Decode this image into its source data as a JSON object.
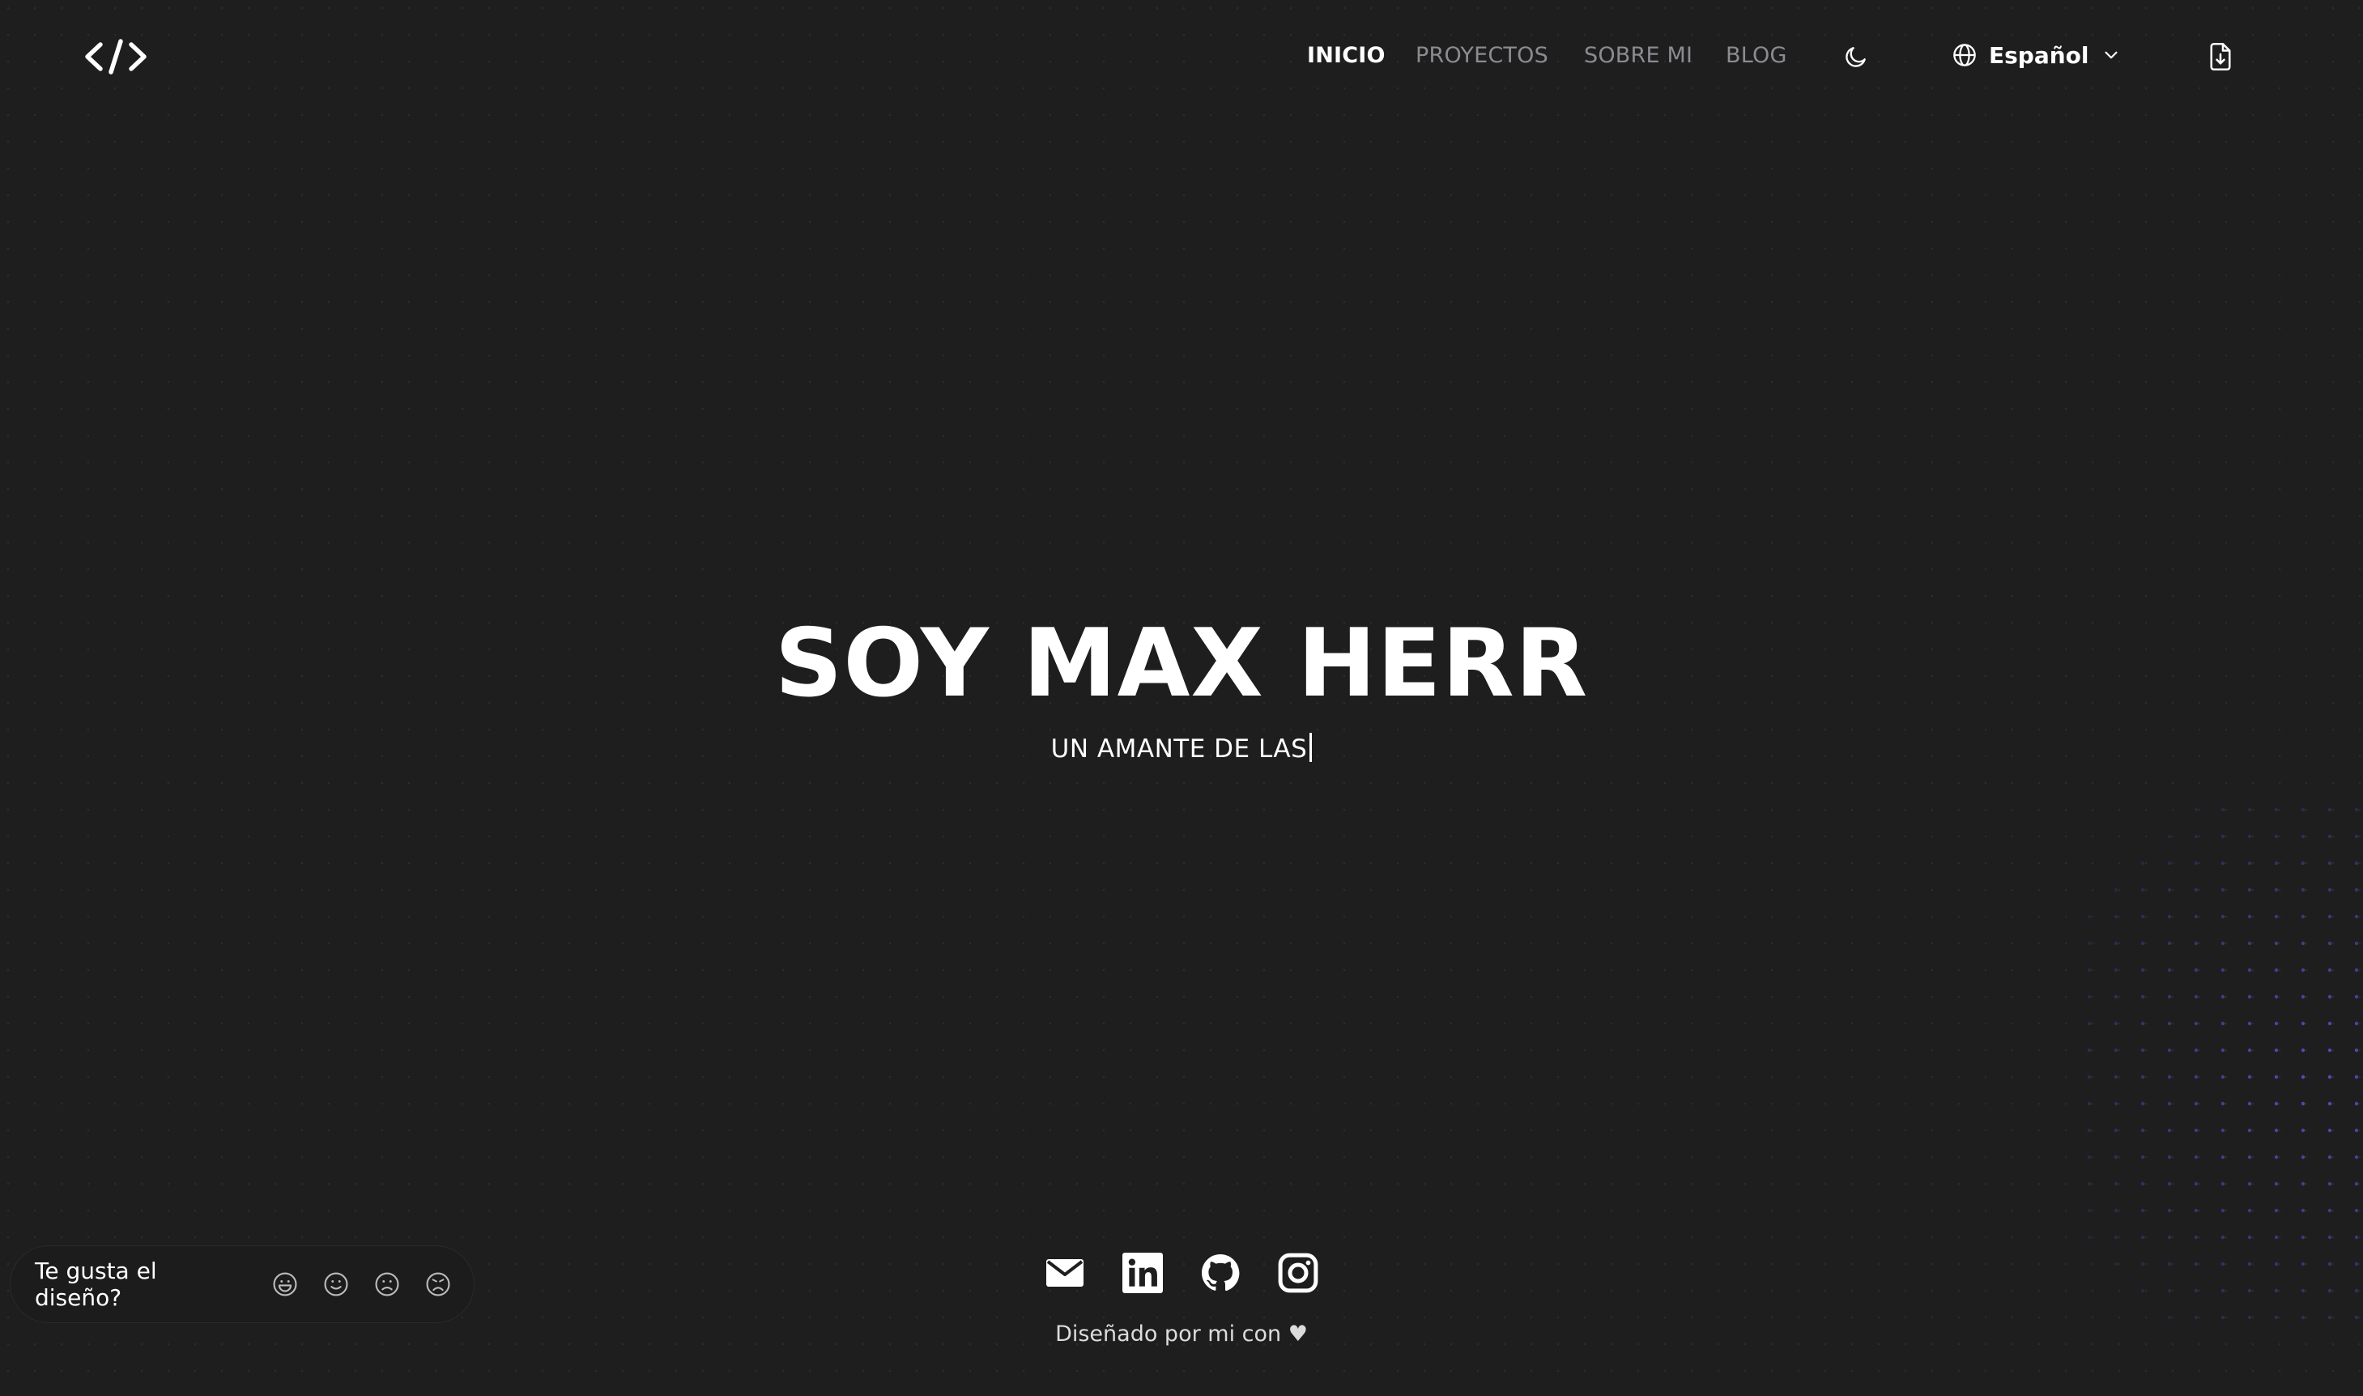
{
  "header": {
    "logo_icon": "code-brackets-icon",
    "nav": [
      {
        "label": "INICIO",
        "active": true
      },
      {
        "label": "PROYECTOS",
        "active": false
      },
      {
        "label": "SOBRE MI",
        "active": false
      },
      {
        "label": "BLOG",
        "active": false
      }
    ],
    "theme_toggle_icon": "moon-icon",
    "language": {
      "label": "Español",
      "icon": "globe-icon"
    },
    "download_cv_icon": "file-download-icon"
  },
  "hero": {
    "title": "SOY MAX HERR",
    "subtitle": "UN AMANTE DE LAS"
  },
  "feedback": {
    "label": "Te gusta el diseño?",
    "options": [
      "very-happy-icon",
      "happy-icon",
      "sad-icon",
      "very-sad-icon"
    ]
  },
  "social": [
    "mail-icon",
    "linkedin-icon",
    "github-icon",
    "instagram-icon"
  ],
  "footer": {
    "text": "Diseñado por mi con ♥"
  },
  "colors": {
    "background": "#1e1e1f",
    "accent_dots": "#5b54d6",
    "nav_inactive": "#8b8b90"
  }
}
